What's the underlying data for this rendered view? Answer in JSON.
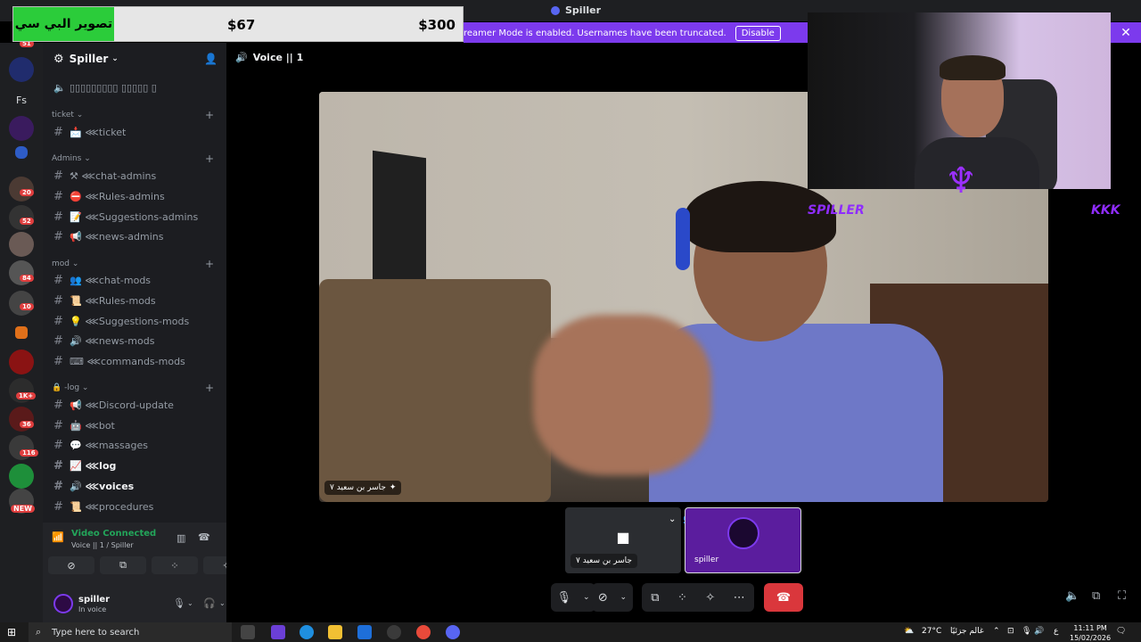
{
  "window": {
    "title": "Spiller"
  },
  "overlay": {
    "label": "تصوير البي سي",
    "amount_current": "$67",
    "amount_goal": "$300"
  },
  "banner": {
    "text": "reamer Mode is enabled. Usernames have been truncated.",
    "disable_label": "Disable",
    "close_icon": "close-icon"
  },
  "rail": {
    "items": [
      {
        "label": ""
      },
      {
        "label": "Fs"
      },
      {
        "label": ""
      },
      {
        "label": ""
      },
      {
        "label": ""
      },
      {
        "label": ""
      },
      {
        "label": ""
      },
      {
        "label": ""
      },
      {
        "label": ""
      },
      {
        "label": ""
      },
      {
        "label": ""
      },
      {
        "label": ""
      },
      {
        "label": ""
      },
      {
        "label": ""
      },
      {
        "label": ""
      },
      {
        "label": ""
      }
    ],
    "badges": [
      "51",
      "20",
      "52",
      "84",
      "10",
      "1K+",
      "36",
      "116",
      "NEW"
    ]
  },
  "server": {
    "name": "Spiller"
  },
  "channels": {
    "voice_top": "▯▯▯▯▯▯▯▯▯ ▯▯▯▯▯ ▯",
    "categories": [
      {
        "name": "ticket",
        "channels": [
          "📩 ⋘ticket"
        ]
      },
      {
        "name": "Admins",
        "channels": [
          "⚒ ⋘chat-admins",
          "⛔ ⋘Rules-admins",
          "📝 ⋘Suggestions-admins",
          "📢 ⋘news-admins"
        ]
      },
      {
        "name": "mod",
        "channels": [
          "👥 ⋘chat-mods",
          "📜 ⋘Rules-mods",
          "💡 ⋘Suggestions-mods",
          "🔊 ⋘news-mods",
          "⌨ ⋘commands-mods"
        ]
      },
      {
        "name": "🔒 -log",
        "channels": [
          "📢 ⋘Discord-update",
          "🤖 ⋘bot",
          "💬 ⋘massages",
          "📈 ⋘log",
          "🔊 ⋘voices",
          "📜 ⋘procedures"
        ]
      }
    ]
  },
  "voice_panel": {
    "status": "Video Connected",
    "location": "Voice || 1 / Spiller"
  },
  "user": {
    "name": "spiller",
    "status": "In voice"
  },
  "call": {
    "title": "Voice || 1",
    "main_tag": "جاسر بن سعيد ٧",
    "tile1_tag": "جاسر بن سعيد ٧",
    "tile2_tag": "spiller"
  },
  "webcam": {
    "name_left": "SPILLER",
    "name_right": "KKK"
  },
  "taskbar": {
    "search_placeholder": "Type here to search",
    "weather": "27°C",
    "weather_desc": "غالم جزئيًا",
    "lang": "ع",
    "time": "11:11 PM",
    "date": "15/02/2026"
  }
}
